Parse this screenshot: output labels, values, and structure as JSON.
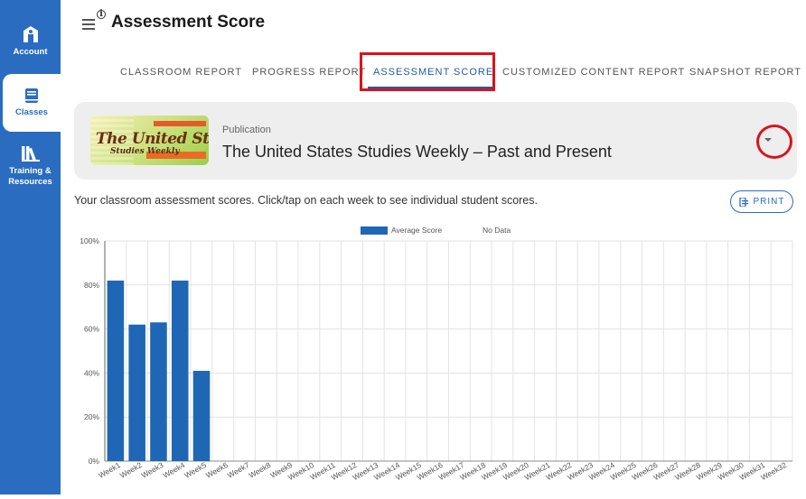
{
  "sidebar": {
    "items": [
      {
        "label": "Account",
        "icon": "account-icon"
      },
      {
        "label": "Classes",
        "icon": "book-icon",
        "active": true
      },
      {
        "label_lines": [
          "Training &",
          "Resources"
        ],
        "icon": "library-icon"
      }
    ]
  },
  "header": {
    "title": "Assessment Score"
  },
  "tabs": [
    {
      "label": "CLASSROOM REPORT"
    },
    {
      "label": "PROGRESS REPORT"
    },
    {
      "label": "ASSESSMENT SCORE",
      "active": true
    },
    {
      "label": "CUSTOMIZED CONTENT REPORT"
    },
    {
      "label": "SNAPSHOT REPORT"
    }
  ],
  "publication": {
    "label": "Publication",
    "name": "The United States Studies Weekly – Past and Present",
    "thumb_title": "The United States",
    "thumb_sub": "Studies Weekly"
  },
  "description": "Your classroom assessment scores. Click/tap on each week to see individual student scores.",
  "print_label": "PRINT",
  "colors": {
    "sidebar": "#2a6cc0",
    "bar": "#1f66b5",
    "accent": "#1f5ca8",
    "highlight": "#d8141c"
  },
  "chart_data": {
    "type": "bar",
    "legend": [
      {
        "name": "Average Score",
        "color": "#1f66b5"
      },
      {
        "name": "No Data",
        "color": "#ffffff"
      }
    ],
    "legend_position": "top-center",
    "ylim": [
      0,
      100
    ],
    "yticks": [
      "0%",
      "20%",
      "40%",
      "60%",
      "80%",
      "100%"
    ],
    "grid": true,
    "categories": [
      "Week1",
      "Week2",
      "Week3",
      "Week4",
      "Week5",
      "Week6",
      "Week7",
      "Week8",
      "Week9",
      "Week10",
      "Week11",
      "Week12",
      "Week13",
      "Week14",
      "Week15",
      "Week16",
      "Week17",
      "Week18",
      "Week19",
      "Week20",
      "Week21",
      "Week22",
      "Week23",
      "Week24",
      "Week25",
      "Week26",
      "Week27",
      "Week28",
      "Week29",
      "Week30",
      "Week31",
      "Week32"
    ],
    "series": [
      {
        "name": "Average Score",
        "values": [
          82,
          62,
          63,
          82,
          41,
          null,
          null,
          null,
          null,
          null,
          null,
          null,
          null,
          null,
          null,
          null,
          null,
          null,
          null,
          null,
          null,
          null,
          null,
          null,
          null,
          null,
          null,
          null,
          null,
          null,
          null,
          null
        ]
      }
    ]
  }
}
